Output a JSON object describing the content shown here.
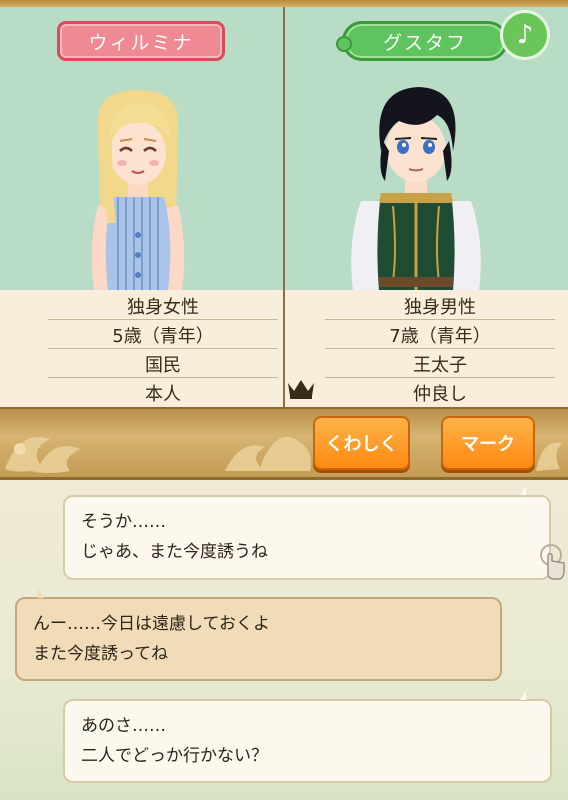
{
  "left_profile": {
    "name": "ウィルミナ",
    "rows": [
      "独身女性",
      "5歳（青年）",
      "国民",
      "本人"
    ]
  },
  "right_profile": {
    "name": "グスタフ",
    "rows": [
      "独身男性",
      "7歳（青年）",
      "王太子",
      "仲良し"
    ]
  },
  "music_icon": "♪",
  "buttons": {
    "detail": "くわしく",
    "mark": "マーク"
  },
  "messages": [
    {
      "line1": "そうか……",
      "line2": "じゃあ、また今度誘うね"
    },
    {
      "line1": "んー……今日は遠慮しておくよ",
      "line2": "また今度誘ってね"
    },
    {
      "line1": "あのさ……",
      "line2": "二人でどっか行かない？"
    }
  ]
}
